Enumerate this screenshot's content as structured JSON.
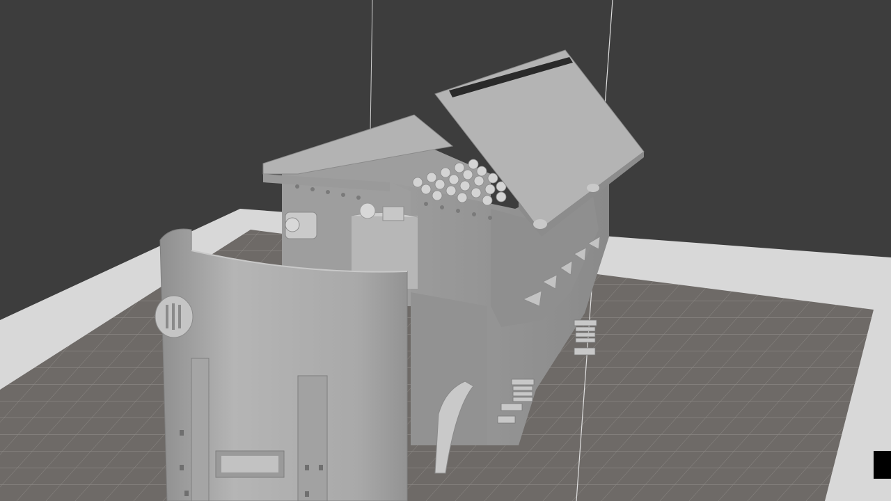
{
  "app": {
    "view": "3d-slicer-build-plate-view",
    "model_name": ""
  },
  "colors": {
    "background": "#3d3d3d",
    "bed_grid": "#6e6a67",
    "bed_border": "#d8d8d8",
    "model": "#a8a8a8"
  },
  "icons": [
    "build-plate-icon",
    "model-icon"
  ]
}
